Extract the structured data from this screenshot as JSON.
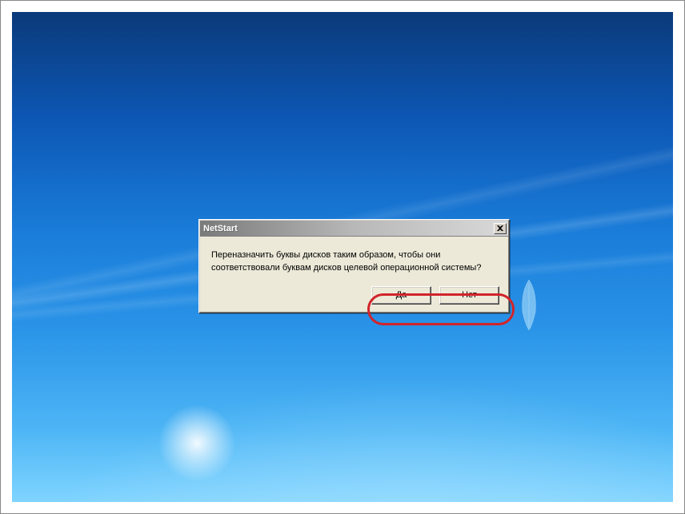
{
  "dialog": {
    "title": "NetStart",
    "message_line1": "Переназначить буквы дисков таким образом, чтобы они",
    "message_line2": "соответствовали буквам дисков целевой операционной системы?",
    "yes_label": "Да",
    "no_label": "Нет"
  }
}
